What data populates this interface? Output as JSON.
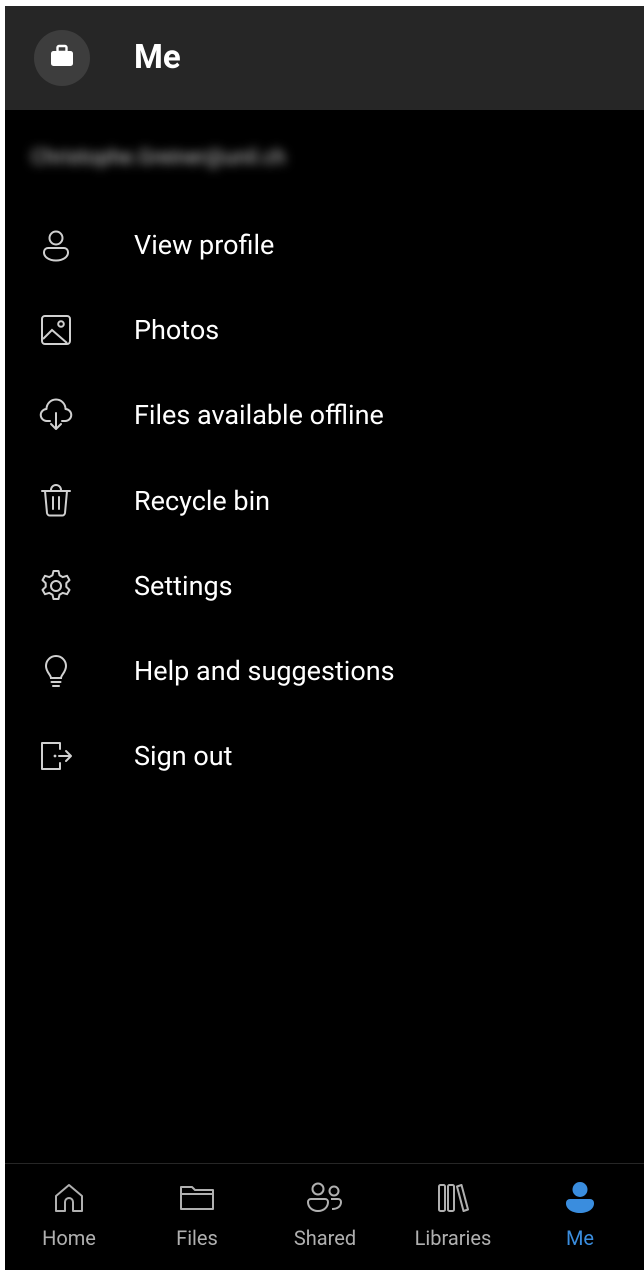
{
  "header": {
    "title": "Me",
    "account_icon": "briefcase-icon"
  },
  "account": {
    "email": "Christophe.Greiner@unil.ch"
  },
  "menu": [
    {
      "label": "View profile",
      "icon": "person-icon"
    },
    {
      "label": "Photos",
      "icon": "photo-icon"
    },
    {
      "label": "Files available offline",
      "icon": "cloud-download-icon"
    },
    {
      "label": "Recycle bin",
      "icon": "trash-icon"
    },
    {
      "label": "Settings",
      "icon": "gear-icon"
    },
    {
      "label": "Help and suggestions",
      "icon": "lightbulb-icon"
    },
    {
      "label": "Sign out",
      "icon": "sign-out-icon"
    }
  ],
  "nav": [
    {
      "label": "Home",
      "icon": "home-icon",
      "active": false
    },
    {
      "label": "Files",
      "icon": "folder-icon",
      "active": false
    },
    {
      "label": "Shared",
      "icon": "people-icon",
      "active": false
    },
    {
      "label": "Libraries",
      "icon": "library-icon",
      "active": false
    },
    {
      "label": "Me",
      "icon": "person-filled-icon",
      "active": true
    }
  ],
  "colors": {
    "accent": "#3a8dde",
    "header_bg": "#262626",
    "background": "#000000",
    "icon_gray": "#b0b0b0"
  }
}
